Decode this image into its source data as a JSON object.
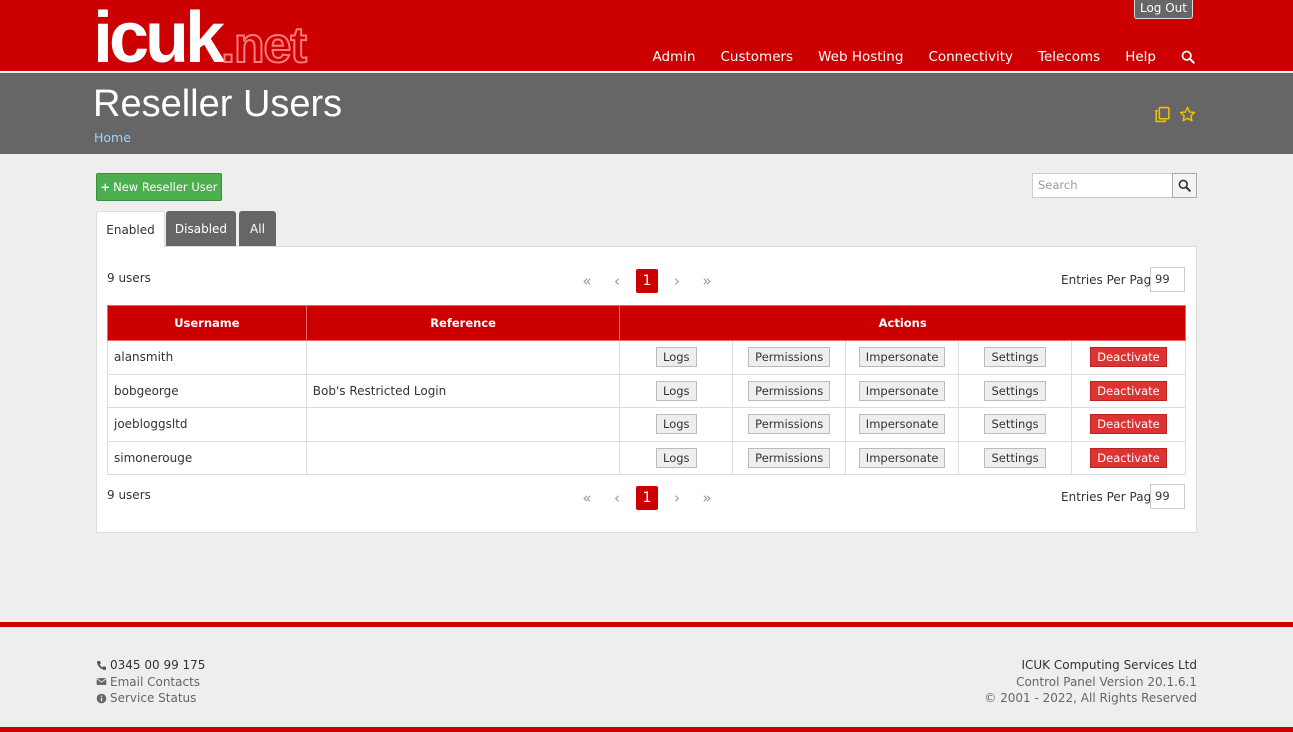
{
  "header": {
    "logo_main": "icuk",
    "logo_suffix": ".net",
    "logout_label": "Log Out",
    "nav": [
      "Admin",
      "Customers",
      "Web Hosting",
      "Connectivity",
      "Telecoms",
      "Help"
    ],
    "search_icon": "search-icon"
  },
  "title": {
    "heading": "Reseller Users",
    "breadcrumb": "Home",
    "icons": [
      "copy-icon",
      "star-icon"
    ],
    "icon_color": "#f0c000"
  },
  "toolbar": {
    "new_button": "New Reseller User",
    "search_placeholder": "Search"
  },
  "tabs": [
    {
      "label": "Enabled",
      "active": true
    },
    {
      "label": "Disabled",
      "active": false
    },
    {
      "label": "All",
      "active": false
    }
  ],
  "list": {
    "count_text": "9 users",
    "current_page": "1",
    "entries_label": "Entries Per Page:",
    "entries_value": "99",
    "columns": [
      "Username",
      "Reference",
      "Actions"
    ],
    "action_labels": [
      "Logs",
      "Permissions",
      "Impersonate",
      "Settings",
      "Deactivate"
    ],
    "rows": [
      {
        "username": "alansmith",
        "reference": ""
      },
      {
        "username": "bobgeorge",
        "reference": "Bob's Restricted Login"
      },
      {
        "username": "joebloggsltd",
        "reference": ""
      },
      {
        "username": "simonerouge",
        "reference": ""
      }
    ]
  },
  "footer": {
    "phone": "0345 00 99 175",
    "email": "Email Contacts",
    "status": "Service Status",
    "company": "ICUK Computing Services Ltd",
    "version": "Control Panel Version 20.1.6.1",
    "copyright": "© 2001 - 2022, All Rights Reserved"
  },
  "colors": {
    "brand_red": "#cc0000",
    "title_gray": "#666666",
    "success_green": "#4cae4c",
    "danger_red": "#dd3333"
  }
}
